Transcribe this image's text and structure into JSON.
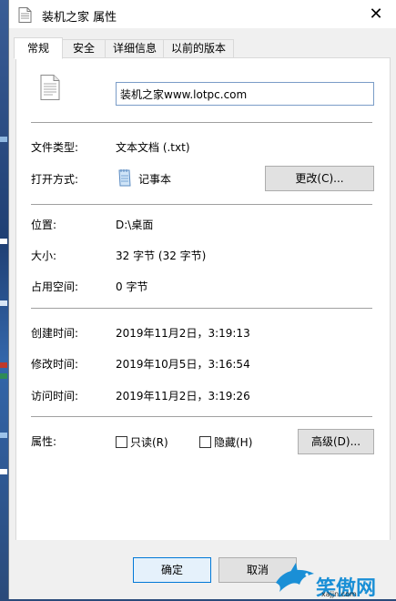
{
  "window": {
    "title": "装机之家 属性"
  },
  "tabs": [
    {
      "label": "常规"
    },
    {
      "label": "安全"
    },
    {
      "label": "详细信息"
    },
    {
      "label": "以前的版本"
    }
  ],
  "general": {
    "file_name": "装机之家www.lotpc.com",
    "file_type": {
      "label": "文件类型:",
      "value": "文本文档 (.txt)"
    },
    "opens_with": {
      "label": "打开方式:",
      "value": "记事本",
      "change_button": "更改(C)..."
    },
    "location": {
      "label": "位置:",
      "value": "D:\\桌面"
    },
    "size": {
      "label": "大小:",
      "value": "32 字节 (32 字节)"
    },
    "size_on_disk": {
      "label": "占用空间:",
      "value": "0 字节"
    },
    "created": {
      "label": "创建时间:",
      "value": "2019年11月2日，3:19:13"
    },
    "modified": {
      "label": "修改时间:",
      "value": "2019年10月5日，3:16:54"
    },
    "accessed": {
      "label": "访问时间:",
      "value": "2019年11月2日，3:19:26"
    },
    "attributes": {
      "label": "属性:",
      "readonly": {
        "label": "只读(R)",
        "checked": false
      },
      "hidden": {
        "label": "隐藏(H)",
        "checked": false
      },
      "advanced_button": "高级(D)..."
    }
  },
  "footer": {
    "ok": "确定",
    "cancel": "取消"
  },
  "watermark": {
    "text": "笑傲网",
    "url": "xajjn.com"
  },
  "colors": {
    "focus_border": "#0078d7",
    "watermark_blue": "#1a8fd6"
  }
}
